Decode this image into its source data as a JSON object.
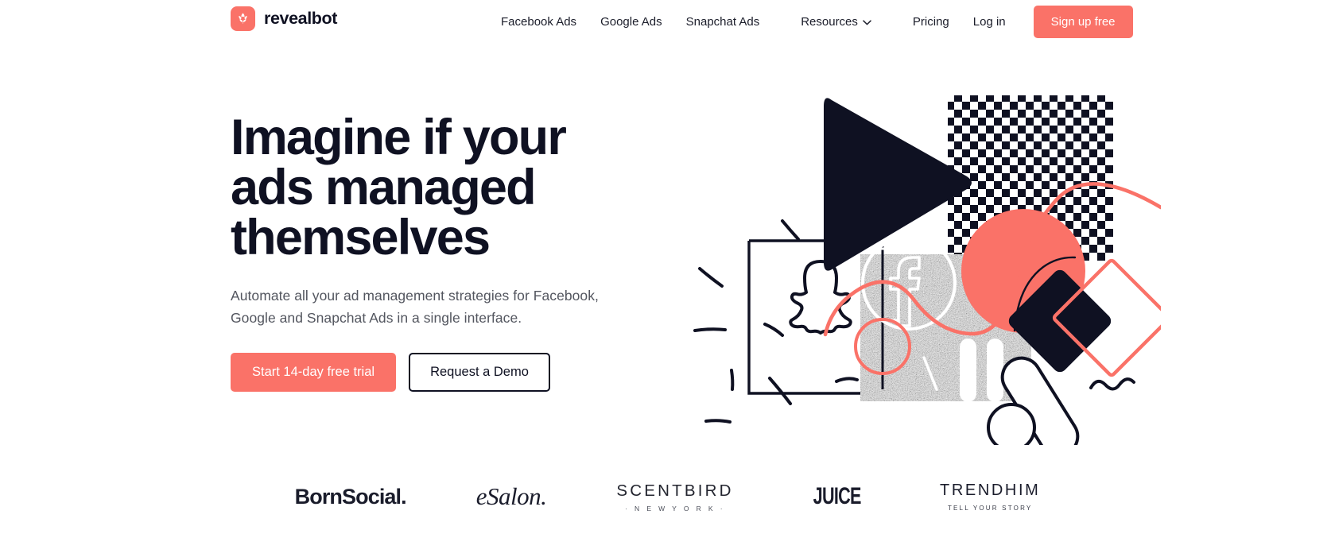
{
  "brand": {
    "name": "revealbot",
    "mark_icon": "revealbot-leaf-icon",
    "mark_color": "#FA7268"
  },
  "colors": {
    "accent": "#FA7268",
    "ink": "#0F1122",
    "muted_text": "#53565F"
  },
  "nav": {
    "items": [
      {
        "label": "Facebook Ads",
        "has_caret": false
      },
      {
        "label": "Google Ads",
        "has_caret": false
      },
      {
        "label": "Snapchat Ads",
        "has_caret": false
      },
      {
        "label": "Resources",
        "has_caret": true
      },
      {
        "label": "Pricing",
        "has_caret": false
      },
      {
        "label": "Log in",
        "has_caret": false
      }
    ],
    "signup_label": "Sign up free"
  },
  "hero": {
    "title": "Imagine if your\nads managed\nthemselves",
    "subtitle": "Automate all your ad management strategies for Facebook,\nGoogle and Snapchat Ads in a single interface.",
    "primary_cta": "Start 14-day free trial",
    "secondary_cta": "Request a Demo",
    "illustration_elements": [
      "play-triangle",
      "facebook-logo",
      "checkerboard-square",
      "coral-circle",
      "coral-curve",
      "noise-square",
      "pause-bars",
      "snapchat-ghost",
      "outlined-square-frame",
      "coral-circle-outline",
      "dark-diamond",
      "coral-diamond-outline",
      "capsule-shapes",
      "squiggle"
    ]
  },
  "logos": [
    {
      "name": "BornSocial",
      "text": "BornSocial.",
      "sub": ""
    },
    {
      "name": "eSalon",
      "text": "eSalon.",
      "sub": ""
    },
    {
      "name": "Scentbird",
      "text": "SCENTBIRD",
      "sub": "· N E W  Y O R K ·"
    },
    {
      "name": "Juice",
      "text": "JUICE",
      "sub": ""
    },
    {
      "name": "Trendhim",
      "text": "TRENDHIM",
      "sub": "TELL YOUR STORY"
    }
  ]
}
